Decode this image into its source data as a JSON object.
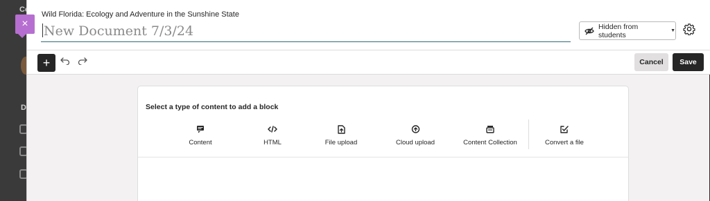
{
  "background": {
    "letters": [
      "Co",
      "B",
      "D"
    ]
  },
  "header": {
    "course_title": "Wild Florida: Ecology and Adventure in the Sunshine State",
    "document_title_placeholder": "New Document 7/3/24",
    "visibility_label": "Hidden from students",
    "close_symbol": "×"
  },
  "toolbar": {
    "add_symbol": "+",
    "cancel_label": "Cancel",
    "save_label": "Save"
  },
  "content_picker": {
    "prompt": "Select a type of content to add a block",
    "types": [
      {
        "label": "Content",
        "icon": "content-icon"
      },
      {
        "label": "HTML",
        "icon": "code-icon"
      },
      {
        "label": "File upload",
        "icon": "file-upload-icon"
      },
      {
        "label": "Cloud upload",
        "icon": "cloud-upload-icon"
      },
      {
        "label": "Content Collection",
        "icon": "content-collection-icon"
      },
      {
        "label": "Convert a file",
        "icon": "convert-file-icon"
      }
    ]
  },
  "colors": {
    "accent_purple": "#b66fd0",
    "title_underline": "#2a6b78",
    "dark_button": "#262626"
  }
}
